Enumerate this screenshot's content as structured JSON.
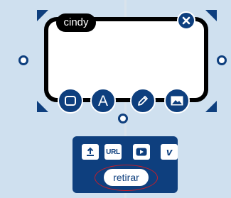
{
  "card": {
    "name_tag": "cindy"
  },
  "tools": [
    {
      "name": "shape",
      "icon": "square-icon"
    },
    {
      "name": "text",
      "icon": "letter-a-icon",
      "glyph": "A"
    },
    {
      "name": "draw",
      "icon": "pencil-icon"
    },
    {
      "name": "image",
      "icon": "image-icon",
      "active": true
    }
  ],
  "media_panel": {
    "upload_icon": "upload-icon",
    "url_label": "URL",
    "youtube_icon": "youtube-icon",
    "vimeo_icon": "vimeo-icon",
    "vimeo_glyph": "v",
    "remove_label": "retirar"
  },
  "colors": {
    "background": "#cfe0ef",
    "brand_navy": "#0e3f7e",
    "frame_border": "#000000",
    "highlight_ring": "#c41e2a"
  }
}
